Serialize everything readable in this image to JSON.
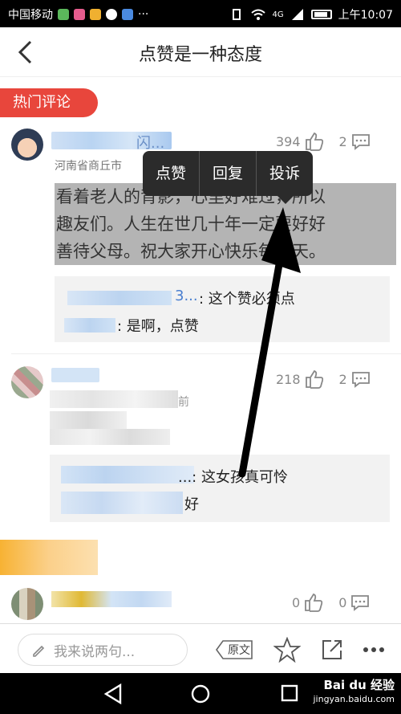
{
  "status_bar": {
    "carrier": "中国移动",
    "time": "上午10:07",
    "net": "4G",
    "more": "···"
  },
  "header": {
    "title": "点赞是一种态度"
  },
  "hot_section": {
    "label": "热门评论"
  },
  "comment1": {
    "username_tail": "闪...",
    "location": "河南省商丘市",
    "likes": "394",
    "comments": "2",
    "text": "看着老人的背影，心里好难过，所以趣友们。人生在世几十年，一定要好好善待父母。祝大家开心快乐每一天。",
    "text_line1": "看着老人的背影，心里好难过，所以",
    "text_line2": "趣友们。人生在世几十年一定要好好",
    "text_line3": "善待父母。祝大家开心快乐每一天。",
    "replies": [
      {
        "user_tail": "3...",
        "text": ": 这个赞必须点"
      },
      {
        "user_tail": "",
        "text": ": 是啊，点赞"
      }
    ]
  },
  "popup_menu": {
    "items": [
      "点赞",
      "回复",
      "投诉"
    ]
  },
  "comment2": {
    "likes": "218",
    "comments": "2",
    "time_tail": "前",
    "replies": [
      {
        "text": "...: 这女孩真可怜"
      },
      {
        "text": "好"
      }
    ]
  },
  "comment3": {
    "likes": "0",
    "comments": "0"
  },
  "input_bar": {
    "placeholder": "我来说两句...",
    "original_label": "原文"
  },
  "watermark": {
    "brand": "Bai du 经验",
    "url": "jingyan.baidu.com"
  },
  "colors": {
    "accent_red": "#e8463c",
    "popup_bg": "#2b2b2b",
    "link_blue": "#4a7fd0"
  }
}
